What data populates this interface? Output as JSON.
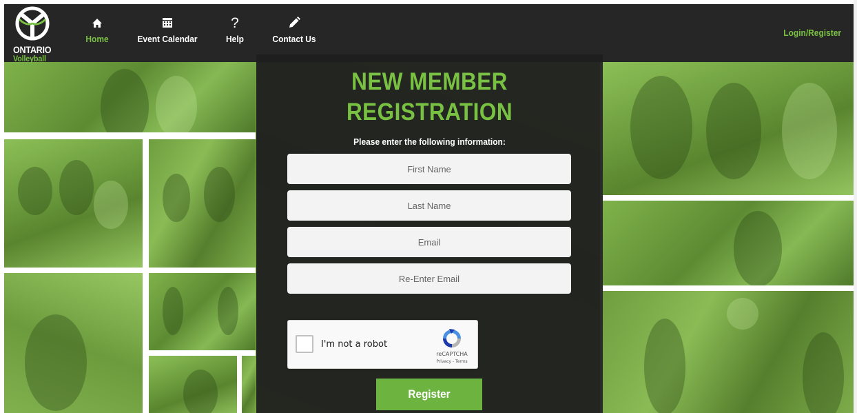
{
  "brand": {
    "line1": "ONTARIO",
    "line2": "Volleyball",
    "accent_color": "#79c143"
  },
  "nav": {
    "items": [
      {
        "label": "Home",
        "icon": "home-icon",
        "active": true
      },
      {
        "label": "Event Calendar",
        "icon": "calendar-icon",
        "active": false
      },
      {
        "label": "Help",
        "icon": "question-icon",
        "active": false
      },
      {
        "label": "Contact Us",
        "icon": "pencil-icon",
        "active": false
      }
    ],
    "login_label": "Login/Register"
  },
  "registration": {
    "title_line1": "NEW MEMBER",
    "title_line2": "REGISTRATION",
    "subtitle": "Please enter the following information:",
    "fields": [
      {
        "placeholder": "First Name",
        "value": ""
      },
      {
        "placeholder": "Last Name",
        "value": ""
      },
      {
        "placeholder": "Email",
        "value": ""
      },
      {
        "placeholder": "Re-Enter Email",
        "value": ""
      }
    ],
    "captcha": {
      "label": "I'm not a robot",
      "brand": "reCAPTCHA",
      "links": "Privacy - Terms",
      "checked": false
    },
    "submit_label": "Register",
    "button_color": "#6db33f"
  }
}
